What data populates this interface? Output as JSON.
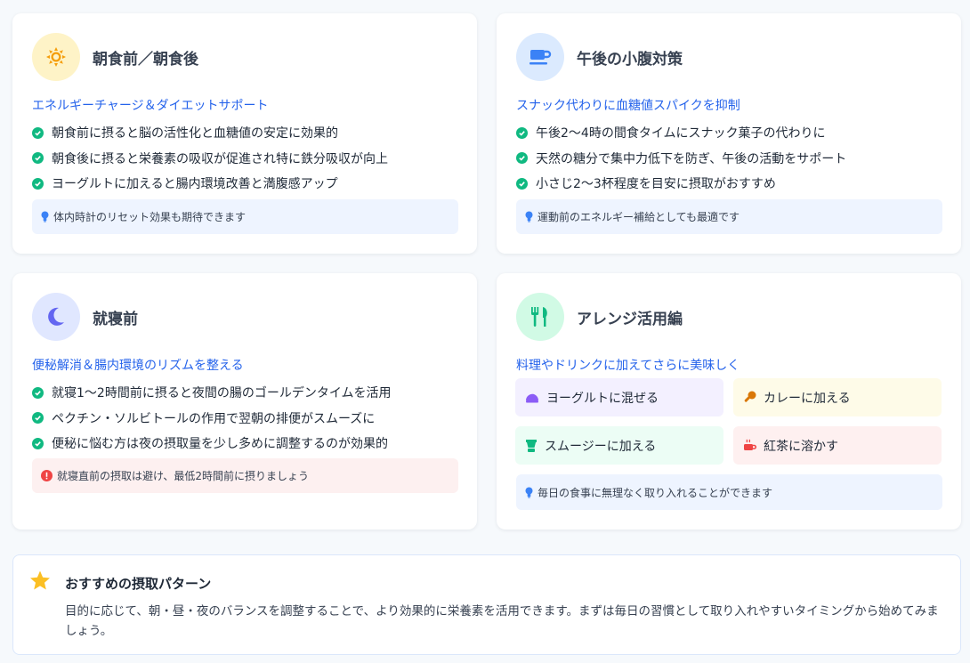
{
  "colors": {
    "accent_blue": "#2563eb",
    "check_green": "#10b981",
    "alert_red": "#ef4444"
  },
  "cards": [
    {
      "title": "朝食前／朝食後",
      "icon": "sun-icon",
      "subtitle": "エネルギーチャージ＆ダイエットサポート",
      "items": [
        "朝食前に摂ると脳の活性化と血糖値の安定に効果的",
        "朝食後に摂ると栄養素の吸収が促進され特に鉄分吸収が向上",
        "ヨーグルトに加えると腸内環境改善と満腹感アップ"
      ],
      "tip": "体内時計のリセット効果も期待できます"
    },
    {
      "title": "午後の小腹対策",
      "icon": "coffee-cup-icon",
      "subtitle": "スナック代わりに血糖値スパイクを抑制",
      "items": [
        "午後2～4時の間食タイムにスナック菓子の代わりに",
        "天然の糖分で集中力低下を防ぎ、午後の活動をサポート",
        "小さじ2～3杯程度を目安に摂取がおすすめ"
      ],
      "tip": "運動前のエネルギー補給としても最適です"
    },
    {
      "title": "就寝前",
      "icon": "moon-icon",
      "subtitle": "便秘解消＆腸内環境のリズムを整える",
      "items": [
        "就寝1～2時間前に摂ると夜間の腸のゴールデンタイムを活用",
        "ペクチン・ソルビトールの作用で翌朝の排便がスムーズに",
        "便秘に悩む方は夜の摂取量を少し多めに調整するのが効果的"
      ],
      "warning": "就寝直前の摂取は避け、最低2時間前に摂りましょう"
    },
    {
      "title": "アレンジ活用編",
      "icon": "utensils-icon",
      "subtitle": "料理やドリンクに加えてさらに美味しく",
      "arrangements": [
        {
          "label": "ヨーグルトに混ぜる",
          "icon": "ice-cream-icon"
        },
        {
          "label": "カレーに加える",
          "icon": "drumstick-icon"
        },
        {
          "label": "スムージーに加える",
          "icon": "blender-icon"
        },
        {
          "label": "紅茶に溶かす",
          "icon": "mug-hot-icon"
        }
      ],
      "tip": "毎日の食事に無理なく取り入れることができます"
    }
  ],
  "recommendation": {
    "icon": "star-icon",
    "title": "おすすめの摂取パターン",
    "text": "目的に応じて、朝・昼・夜のバランスを調整することで、より効果的に栄養素を活用できます。まずは毎日の習慣として取り入れやすいタイミングから始めてみましょう。"
  }
}
